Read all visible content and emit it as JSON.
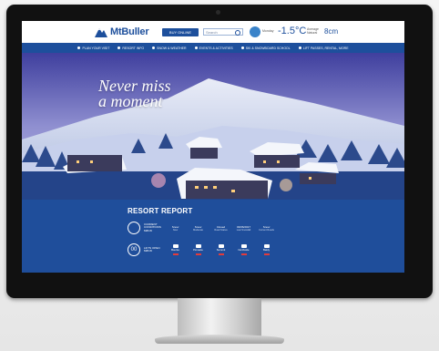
{
  "header": {
    "logo_text": "MtBuller",
    "ski_button": "BUY ONLINE",
    "search_placeholder": "Search",
    "weather_label": "Monday",
    "temperature": "-1.5°C",
    "snow_avg_label": "Average Natural",
    "snow_depth": "8cm"
  },
  "nav": {
    "items": [
      {
        "label": "PLAN YOUR VISIT",
        "icon": "map-icon"
      },
      {
        "label": "RESORT INFO",
        "icon": "info-icon"
      },
      {
        "label": "SNOW & WEATHER",
        "icon": "snowflake-icon"
      },
      {
        "label": "EVENTS & ACTIVITIES",
        "icon": "calendar-icon"
      },
      {
        "label": "SKI & SNOWBOARD SCHOOL",
        "icon": "ski-icon"
      },
      {
        "label": "LIFT PASSES, RENTAL, MORE",
        "icon": "ticket-icon"
      }
    ]
  },
  "hero": {
    "title_line1": "Never miss",
    "title_line2": "a moment"
  },
  "report": {
    "title": "RESORT REPORT",
    "conditions_label": "CURRENT CONDITIONS",
    "conditions_sub": "MtB.W",
    "stats": [
      {
        "value": "Snow",
        "sub": "Now"
      },
      {
        "value": "Snow",
        "sub": "Moderate"
      },
      {
        "value": "Closed",
        "sub": "Road Status"
      },
      {
        "value": "03/06/2017",
        "sub": "Last Snowfall"
      },
      {
        "value": "Snow",
        "sub": "Current Roads"
      }
    ],
    "lifts_icon_text": "00",
    "lifts_label": "LIFTS OPEN",
    "lifts_sub": "MtB.W",
    "lifts": [
      {
        "name": "Bourke",
        "status_color": "#e23b3b"
      },
      {
        "name": "Pinnacle",
        "status_color": "#e23b3b"
      },
      {
        "name": "Summit",
        "status_color": "#e23b3b"
      },
      {
        "name": "Northside",
        "status_color": "#e23b3b"
      },
      {
        "name": "Baldy",
        "status_color": "#e23b3b"
      }
    ]
  },
  "colors": {
    "brand_blue": "#1d4f9c",
    "report_blue": "#1f4e9b",
    "status_closed": "#e23b3b"
  }
}
